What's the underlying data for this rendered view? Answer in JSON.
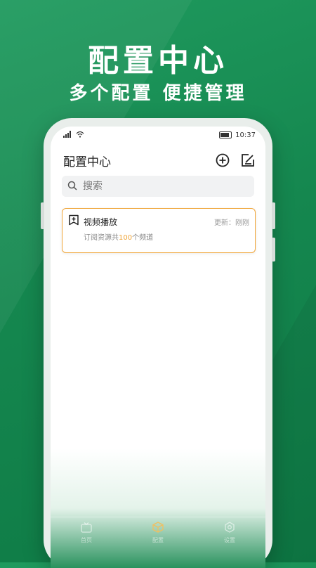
{
  "promo": {
    "headline": "配置中心",
    "subline": "多个配置 便捷管理"
  },
  "status_bar": {
    "time": "10:37",
    "signal_icon": "signal-icon",
    "wifi_icon": "wifi-icon",
    "battery_icon": "battery-icon"
  },
  "header": {
    "title": "配置中心",
    "add_icon": "add-circle-icon",
    "edit_icon": "edit-icon"
  },
  "search": {
    "placeholder": "搜索",
    "icon": "search-icon"
  },
  "cards": [
    {
      "icon": "bookmark-add-icon",
      "name": "视频播放",
      "update_label": "更新：刚刚",
      "desc_prefix": "订阅资源共",
      "count": "100",
      "desc_suffix": "个频道"
    }
  ],
  "tabs": [
    {
      "label": "首页",
      "icon": "tv-icon"
    },
    {
      "label": "配置",
      "icon": "cube-icon"
    },
    {
      "label": "设置",
      "icon": "gear-icon"
    }
  ],
  "colors": {
    "brand_green": "#15874f",
    "accent_orange": "#f0a63a"
  }
}
